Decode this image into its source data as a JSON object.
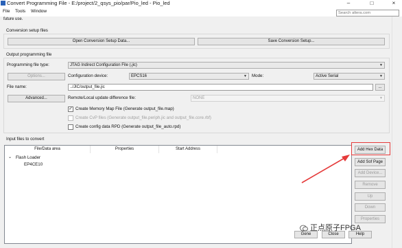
{
  "window": {
    "title": "Convert Programming File - E:/project/2_qsys_pio/par/Pio_led - Pio_led",
    "controls": [
      "–",
      "□",
      "×"
    ]
  },
  "menu": [
    "File",
    "Tools",
    "Window"
  ],
  "search": {
    "placeholder": "Search altera.com"
  },
  "intro_text": "future use.",
  "conversion_setup": {
    "label": "Conversion setup files",
    "open_button": "Open Conversion Setup Data...",
    "save_button": "Save Conversion Setup..."
  },
  "output": {
    "label": "Output programming file",
    "file_type_label": "Programming file type:",
    "file_type_value": "JTAG Indirect Configuration File (.jic)",
    "options_button": "Options...",
    "config_device_label": "Configuration device:",
    "config_device_value": "EPCS16",
    "mode_label": "Mode:",
    "mode_value": "Active Serial",
    "file_name_label": "File name:",
    "file_name_value": "../JIC/output_file.jic",
    "browse_button": "...",
    "advanced_button": "Advanced...",
    "remote_label": "Remote/Local update difference file:",
    "remote_value": "NONE",
    "memory_map": {
      "label": "Create Memory Map File (Generate output_file.map)",
      "checked": true
    },
    "cvp_files": {
      "label": "Create CvP files (Generate output_file.periph.jic and output_file.core.rbf)",
      "checked": false
    },
    "rpd": {
      "label": "Create config data RPD (Generate output_file_auto.rpd)",
      "checked": false
    }
  },
  "input": {
    "label": "Input files to convert",
    "columns": [
      "File/Data area",
      "Properties",
      "Start Address"
    ],
    "tree": [
      {
        "label": "Flash Loader",
        "expander": "⌄"
      },
      {
        "label": "EP4CE10"
      }
    ],
    "buttons": {
      "add_hex": "Add Hex Data",
      "add_sof": "Add Sof Page",
      "add_device": "Add Device...",
      "remove": "Remove",
      "up": "Up",
      "down": "Down",
      "properties": "Properties"
    }
  },
  "footer": {
    "generate": "Gene",
    "close": "Close",
    "help": "Help"
  },
  "watermark": "正点原子FPGA",
  "colors": {
    "highlight": "#e53a3a",
    "arrow": "#e53a3a"
  }
}
